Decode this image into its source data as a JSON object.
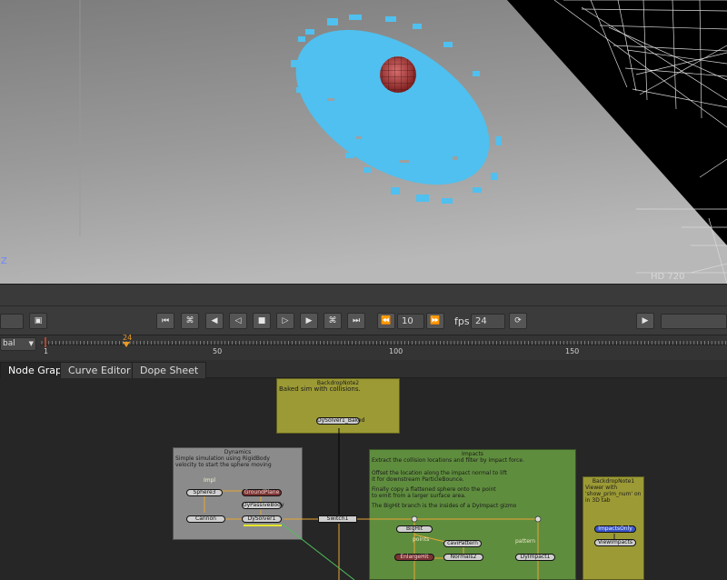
{
  "viewport": {
    "resolution_label": "HD 720",
    "axis_label": "Z"
  },
  "playbar": {
    "step_value": "10",
    "fps_label": "fps",
    "fps_value": "24",
    "buttons": [
      "first-frame",
      "previous-keyframe",
      "step-back",
      "play-backward",
      "stop",
      "play-forward",
      "step-forward",
      "next-keyframe",
      "last-frame"
    ]
  },
  "timeline": {
    "scope_value": "bal",
    "current_frame": "24",
    "tick_labels": [
      "1",
      "50",
      "100",
      "150"
    ]
  },
  "tabs": [
    "Node Graph",
    "Curve Editor",
    "Dope Sheet"
  ],
  "graph": {
    "backdrops": {
      "baked": {
        "title": "BackdropNote2",
        "text": "Baked sim with collisions.",
        "color": "#9c9a35"
      },
      "dynamics": {
        "title": "Dynamics",
        "text": "Simple simulation using RigidBody velocity to start the sphere moving",
        "color": "#8b8b8b"
      },
      "impacts": {
        "title": "Impacts",
        "line1": "Extract the collision locations and filter by impact force.",
        "line2": "Offset the location along the impact normal to lift it for downstream ParticleBounce.",
        "line3": "Finally copy a flattened sphere onto the point to emit from a larger surface area.",
        "line4": "The BigHit branch is the insides of a DyImpact gizmo",
        "color": "#5f8d3e"
      },
      "note1": {
        "title": "BackdropNote1",
        "text": "Viewer with 'show_prim_num' on in 3D tab",
        "color": "#9c9a35"
      }
    },
    "nodes": {
      "dysolver_baked": "DySolver1_Baked",
      "sphere3": "Sphere3",
      "impl": "Impl",
      "groundplane": "GroundPlane",
      "dypassivebody": "DyPassiveBody",
      "cannon": "Cannon",
      "dysolver1": "DySolver1",
      "switch1": "Switch1",
      "bighit": "BigHit",
      "points": "points",
      "cavepattern": "caviPattern",
      "enlargehit": "EnlargeHit",
      "normals2": "Normals2",
      "pattern": "pattern",
      "dyimpact1": "DyImpact1",
      "impactsonly": "ImpactsOnly",
      "viewimpacts": "ViewImpacts"
    }
  }
}
